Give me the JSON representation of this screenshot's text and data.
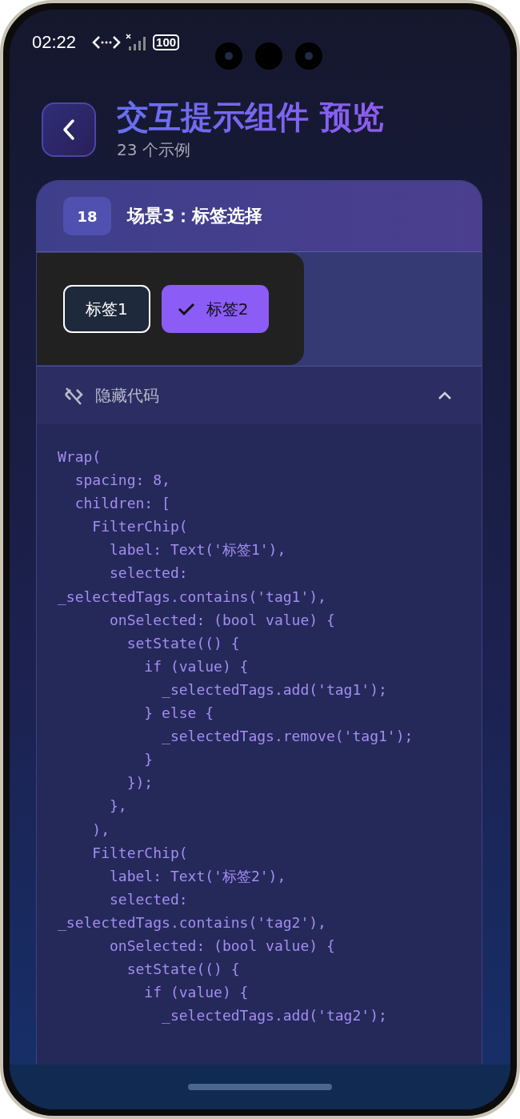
{
  "status_bar": {
    "time": "02:22",
    "battery": "100"
  },
  "header": {
    "title": "交互提示组件 预览",
    "subtitle": "23 个示例"
  },
  "card": {
    "badge": "18",
    "title": "场景3：标签选择",
    "chips": [
      {
        "label": "标签1",
        "selected": false
      },
      {
        "label": "标签2",
        "selected": true
      }
    ],
    "code_toggle": {
      "label": "隐藏代码",
      "expanded": true
    },
    "code_lines": [
      "Wrap(",
      "  spacing: 8,",
      "  children: [",
      "    FilterChip(",
      "      label: Text('标签1'),",
      "      selected:",
      "_selectedTags.contains('tag1'),",
      "      onSelected: (bool value) {",
      "        setState(() {",
      "          if (value) {",
      "            _selectedTags.add('tag1');",
      "          } else {",
      "            _selectedTags.remove('tag1');",
      "          }",
      "        });",
      "      },",
      "    ),",
      "    FilterChip(",
      "      label: Text('标签2'),",
      "      selected:",
      "_selectedTags.contains('tag2'),",
      "      onSelected: (bool value) {",
      "        setState(() {",
      "          if (value) {",
      "            _selectedTags.add('tag2');"
    ]
  }
}
